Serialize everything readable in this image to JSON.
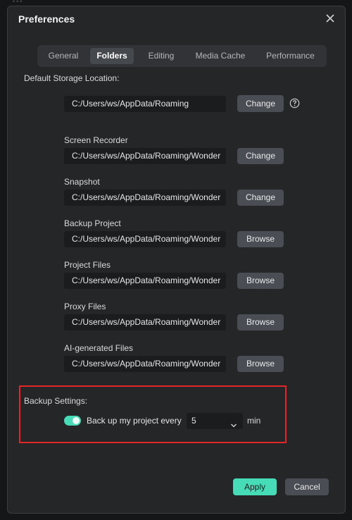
{
  "dialog": {
    "title": "Preferences",
    "close_icon": "close-icon"
  },
  "tabs": [
    {
      "label": "General",
      "active": false
    },
    {
      "label": "Folders",
      "active": true
    },
    {
      "label": "Editing",
      "active": false
    },
    {
      "label": "Media Cache",
      "active": false
    },
    {
      "label": "Performance",
      "active": false
    }
  ],
  "default_storage": {
    "label": "Default Storage Location:",
    "path": "C:/Users/ws/AppData/Roaming",
    "button": "Change",
    "help_icon": "question-circle-icon"
  },
  "folders": [
    {
      "label": "Screen Recorder",
      "path": "C:/Users/ws/AppData/Roaming/Wonder",
      "button": "Change"
    },
    {
      "label": "Snapshot",
      "path": "C:/Users/ws/AppData/Roaming/Wonder",
      "button": "Change"
    },
    {
      "label": "Backup Project",
      "path": "C:/Users/ws/AppData/Roaming/Wonder",
      "button": "Browse"
    },
    {
      "label": "Project Files",
      "path": "C:/Users/ws/AppData/Roaming/Wonder",
      "button": "Browse"
    },
    {
      "label": "Proxy Files",
      "path": "C:/Users/ws/AppData/Roaming/Wonder",
      "button": "Browse"
    },
    {
      "label": "AI-generated Files",
      "path": "C:/Users/ws/AppData/Roaming/Wonder",
      "button": "Browse"
    }
  ],
  "backup": {
    "label": "Backup Settings:",
    "toggle_on": true,
    "text": "Back up my project every",
    "interval": "5",
    "unit": "min"
  },
  "footer": {
    "apply": "Apply",
    "cancel": "Cancel"
  },
  "colors": {
    "accent": "#46dcb7",
    "highlight_border": "#e0262b",
    "dialog_bg": "#242628"
  }
}
